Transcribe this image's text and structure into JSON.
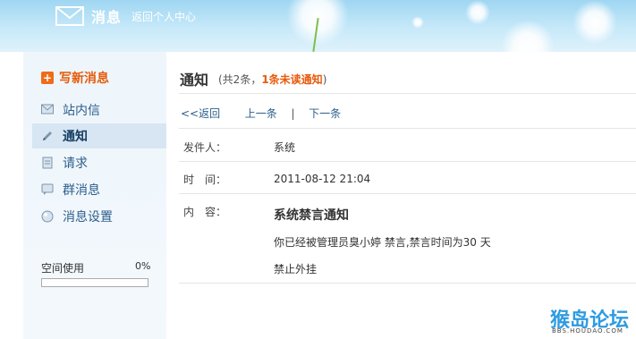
{
  "header": {
    "title": "消息",
    "subtitle": "返回个人中心"
  },
  "sidebar": {
    "compose_label": "写新消息",
    "items": [
      {
        "label": "站内信",
        "icon": "mail-icon",
        "active": false
      },
      {
        "label": "通知",
        "icon": "pencil-icon",
        "active": true
      },
      {
        "label": "请求",
        "icon": "document-icon",
        "active": false
      },
      {
        "label": "群消息",
        "icon": "chat-icon",
        "active": false
      },
      {
        "label": "消息设置",
        "icon": "globe-icon",
        "active": false
      }
    ],
    "space_label": "空间使用",
    "space_percent": "0%"
  },
  "main": {
    "title": "通知",
    "count_text": "(共2条，",
    "unread_text": "1条未读通知",
    "count_close": ")",
    "back_link": "<<返回",
    "prev_link": "上一条",
    "separator": "|",
    "next_link": "下一条",
    "sender_label": "发件人：",
    "sender_value": "系统",
    "time_label": "时　间：",
    "time_value": "2011-08-12 21:04",
    "content_label": "内　容：",
    "message_title": "系统禁言通知",
    "message_line1": "你已经被管理员臭小婷 禁言,禁言时间为30 天",
    "message_line2": "禁止外挂"
  },
  "watermark": {
    "main": "猴岛论坛",
    "sub": "BBS.HOUDAO.COM"
  },
  "colors": {
    "accent_orange": "#e75a0b",
    "link_blue": "#2c5e8c",
    "header_sky": "#9fd6f2"
  }
}
